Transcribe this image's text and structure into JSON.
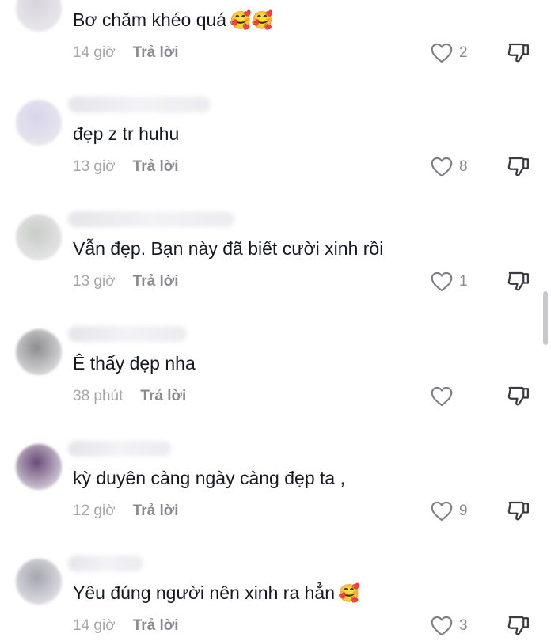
{
  "comments": [
    {
      "text": "Bơ chăm khéo quá",
      "emoji": "🥰🥰",
      "time": "14 giờ",
      "reply": "Trả lời",
      "likes": "2",
      "avatar_color": "#d9d4dc"
    },
    {
      "text": "đẹp z tr huhu",
      "emoji": "",
      "time": "13 giờ",
      "reply": "Trả lời",
      "likes": "8",
      "avatar_color": "#d8d4ea"
    },
    {
      "text": "Vẫn đẹp. Bạn này đã biết cười xinh rồi",
      "emoji": "",
      "time": "13 giờ",
      "reply": "Trả lời",
      "likes": "1",
      "avatar_color": "#c9ccc7"
    },
    {
      "text": "Ê thấy đẹp nha",
      "emoji": "",
      "time": "38 phút",
      "reply": "Trả lời",
      "likes": "",
      "avatar_color": "#8c8d8e"
    },
    {
      "text": "kỳ duyên càng ngày càng đẹp ta ,",
      "emoji": "",
      "time": "12 giờ",
      "reply": "Trả lời",
      "likes": "9",
      "avatar_color": "#6a4a78"
    },
    {
      "text": "Yêu đúng người nên xinh ra hẳn",
      "emoji": "🥰",
      "time": "14 giờ",
      "reply": "Trả lời",
      "likes": "3",
      "avatar_color": "#a5a6b0"
    }
  ],
  "icons": {
    "like": "heart-outline-icon",
    "dislike": "thumbs-down-icon"
  },
  "colors": {
    "text": "#161823",
    "muted": "#8a8b91",
    "time": "#a6a7ab"
  }
}
